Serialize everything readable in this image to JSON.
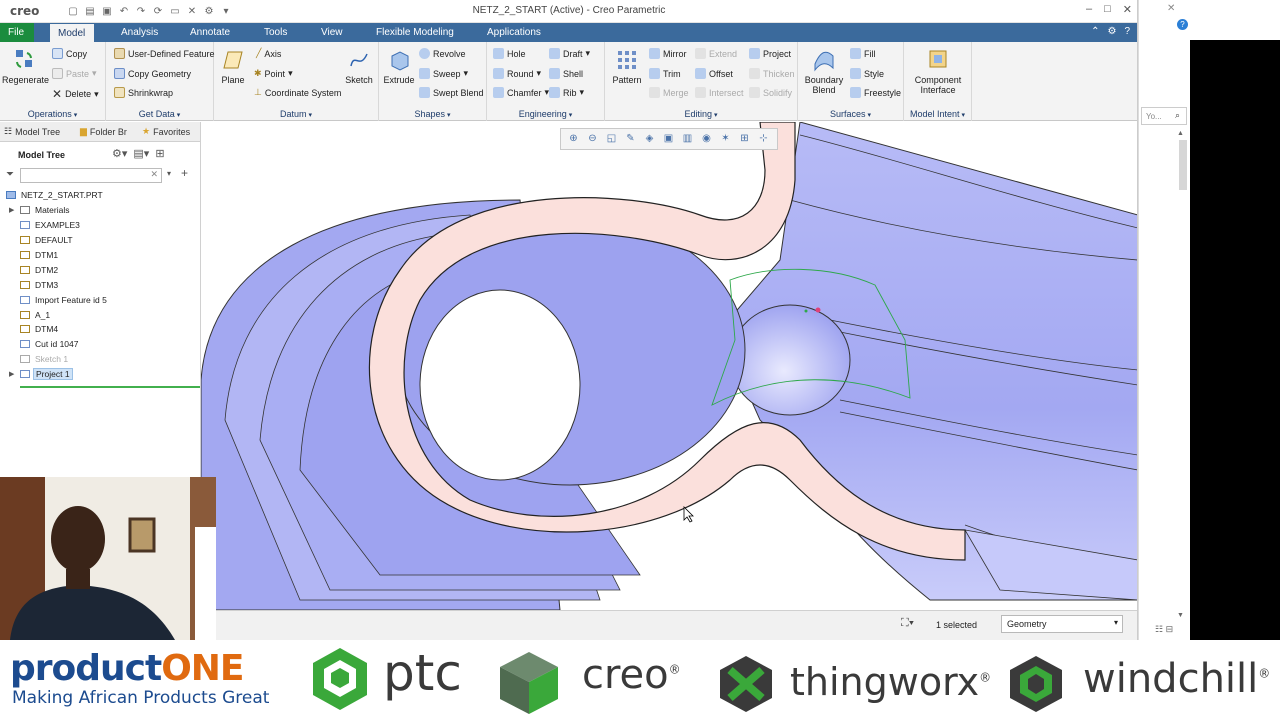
{
  "app": {
    "logo": "creo",
    "window_title": "NETZ_2_START (Active) - Creo Parametric"
  },
  "tabs": [
    "File",
    "Model",
    "Analysis",
    "Annotate",
    "Tools",
    "View",
    "Flexible Modeling",
    "Applications"
  ],
  "active_tab": "Model",
  "ribbon": {
    "operations": {
      "label": "Operations",
      "regenerate": "Regenerate",
      "copy": "Copy",
      "paste": "Paste",
      "delete": "Delete"
    },
    "getdata": {
      "label": "Get Data",
      "udf": "User-Defined Feature",
      "copy_geometry": "Copy Geometry",
      "shrinkwrap": "Shrinkwrap"
    },
    "datum": {
      "label": "Datum",
      "plane": "Plane",
      "axis": "Axis",
      "point": "Point",
      "csys": "Coordinate System",
      "sketch": "Sketch"
    },
    "shapes": {
      "label": "Shapes",
      "extrude": "Extrude",
      "revolve": "Revolve",
      "sweep": "Sweep",
      "swept_blend": "Swept Blend"
    },
    "engineering": {
      "label": "Engineering",
      "hole": "Hole",
      "round": "Round",
      "chamfer": "Chamfer",
      "draft": "Draft",
      "shell": "Shell",
      "rib": "Rib"
    },
    "editing": {
      "label": "Editing",
      "pattern": "Pattern",
      "mirror": "Mirror",
      "trim": "Trim",
      "merge": "Merge",
      "extend": "Extend",
      "offset": "Offset",
      "intersect": "Intersect",
      "project": "Project",
      "thicken": "Thicken",
      "solidify": "Solidify"
    },
    "surfaces": {
      "label": "Surfaces",
      "boundary_blend": "Boundary Blend",
      "fill": "Fill",
      "style": "Style",
      "freestyle": "Freestyle"
    },
    "model_intent": {
      "label": "Model Intent",
      "component_interface": "Component Interface"
    }
  },
  "left_panel": {
    "tabs": [
      "Model Tree",
      "Folder Br",
      "Favorites"
    ],
    "heading": "Model Tree",
    "tree": [
      {
        "label": "NETZ_2_START.PRT",
        "icon": "part-icon",
        "root": true
      },
      {
        "label": "Materials",
        "icon": "materials-icon",
        "expand": true
      },
      {
        "label": "EXAMPLE3",
        "icon": "layer-icon"
      },
      {
        "label": "DEFAULT",
        "icon": "csys-icon"
      },
      {
        "label": "DTM1",
        "icon": "datum-plane-icon"
      },
      {
        "label": "DTM2",
        "icon": "datum-plane-icon"
      },
      {
        "label": "DTM3",
        "icon": "datum-plane-icon"
      },
      {
        "label": "Import Feature id 5",
        "icon": "import-icon"
      },
      {
        "label": "A_1",
        "icon": "axis-icon"
      },
      {
        "label": "DTM4",
        "icon": "datum-plane-icon"
      },
      {
        "label": "Cut id 1047",
        "icon": "cut-icon"
      },
      {
        "label": "Sketch 1",
        "icon": "sketch-icon",
        "gray": true
      },
      {
        "label": "Project 1",
        "icon": "project-icon",
        "expand": true,
        "selected": true
      }
    ]
  },
  "status": {
    "selected": "1 selected",
    "filter": "Geometry"
  },
  "right_strip": {
    "search_placeholder": "Yo..."
  },
  "banner": {
    "productone_a": "product",
    "productone_b": "ONE",
    "tagline": "Making African Products Great",
    "ptc": "ptc",
    "creo": "creo",
    "thingworx": "thingworx",
    "windchill": "windchill",
    "reg": "®"
  },
  "colors": {
    "tabbar": "#3b6a9c",
    "file_tab": "#1b8c3e",
    "part_fill": "#a9aef5",
    "section_fill": "#fbe0dc",
    "ptc_green": "#3aa83a"
  }
}
